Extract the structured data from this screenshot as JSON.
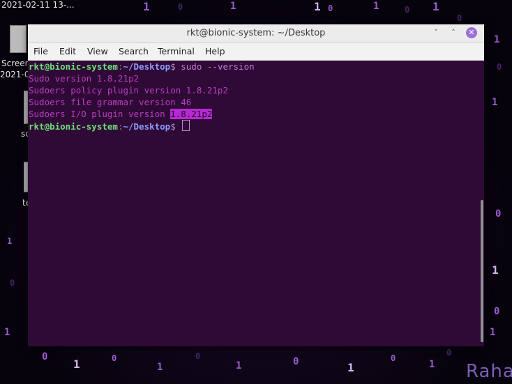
{
  "desktop": {
    "icon1_label_a": "Screen",
    "icon1_label_b": "2021-0",
    "top_label": "2021-02-11 13-...",
    "icon2_label": "sc",
    "icon3_label": "te",
    "brand": "Raha"
  },
  "window": {
    "title": "rkt@bionic-system: ~/Desktop",
    "min_symbol": "˅",
    "max_symbol": "˄",
    "close_symbol": "✕",
    "menu": [
      "File",
      "Edit",
      "View",
      "Search",
      "Terminal",
      "Help"
    ]
  },
  "terminal": {
    "user_host": "rkt@bionic-system",
    "separator": ":",
    "path": "~/Desktop",
    "prompt_symbol": "$",
    "command": " sudo --version",
    "output": [
      "Sudo version 1.8.21p2",
      "Sudoers policy plugin version 1.8.21p2",
      "Sudoers file grammar version 46"
    ],
    "io_prefix": "Sudoers I/O plugin version ",
    "io_highlight": "1.8.21p2"
  }
}
